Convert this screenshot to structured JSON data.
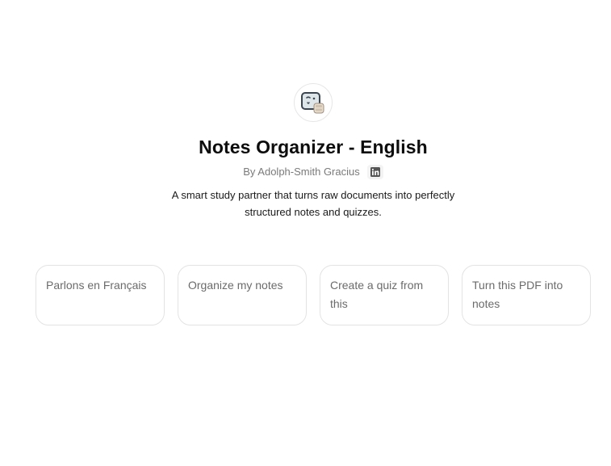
{
  "gpt": {
    "avatar_icon": "notes-organizer-face-icon",
    "title": "Notes Organizer - English",
    "byline": "By Adolph-Smith Gracius",
    "social_icon": "linkedin-icon",
    "description": "A smart study partner that turns raw documents into perfectly structured notes and quizzes."
  },
  "conversation_starters": [
    {
      "label": "Parlons en Français"
    },
    {
      "label": "Organize my notes"
    },
    {
      "label": "Create a quiz from this"
    },
    {
      "label": "Turn this PDF into notes"
    }
  ],
  "colors": {
    "background": "#ffffff",
    "title": "#0d0d0d",
    "muted": "#7a7a7a",
    "card_border": "#e3e3e3",
    "card_text": "#6b6b6b"
  }
}
